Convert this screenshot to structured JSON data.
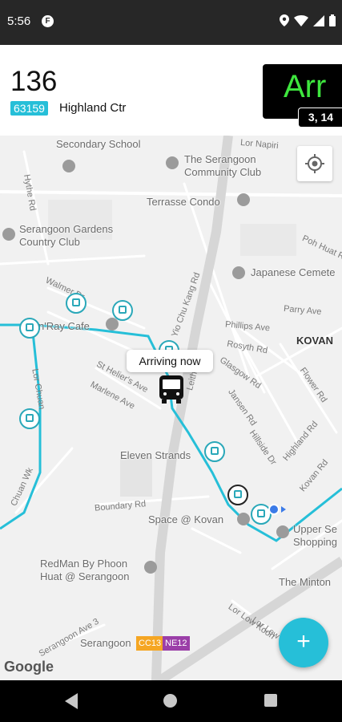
{
  "status_bar": {
    "time": "5:56",
    "app_icon": "F",
    "icons": [
      "location-icon",
      "wifi-icon",
      "signal-icon",
      "battery-icon"
    ]
  },
  "header": {
    "route_number": "136",
    "stop_code": "63159",
    "stop_name": "Highland Ctr",
    "arrival": "Arr",
    "arrival_sub": "3, 14"
  },
  "map": {
    "places": [
      "Secondary School",
      "The Serangoon Community Club",
      "Terrasse Condo",
      "Serangoon Gardens Country Club",
      "Japanese Cemete",
      "KOVAN",
      "n'Ray Cafe",
      "Eleven Strands",
      "Space @ Kovan",
      "Upper Se Shopping",
      "RedMan By Phoon Huat @ Serangoon",
      "The Minton",
      "Serangoon"
    ],
    "roads": [
      "Lor Napiri",
      "Hythe Rd",
      "Poh Huat Rd",
      "Parry Ave",
      "Phillips Ave",
      "Rosyth Rd",
      "Glasgow Rd",
      "Flower Rd",
      "Jansen Rd",
      "Highland Rd",
      "Hillside Dr",
      "Kovan Rd",
      "Walmer Dr",
      "Lor Chuan",
      "St Helier's Ave",
      "Marlene Ave",
      "Yio Chu Kang Rd",
      "Leith",
      "Boundary Rd",
      "Chuan Wk",
      "Serangoon Ave 3",
      "Lor Low Koon",
      "Lor Lew Lian"
    ],
    "tooltip": "Arriving now",
    "mrt_codes": [
      "CC13",
      "NE12"
    ],
    "mrt_colors": [
      "#f5a623",
      "#9b3fa8"
    ],
    "route_color": "#26bfd8",
    "attribution": "Google"
  },
  "fab_label": "+",
  "accent": "#26bfd8"
}
